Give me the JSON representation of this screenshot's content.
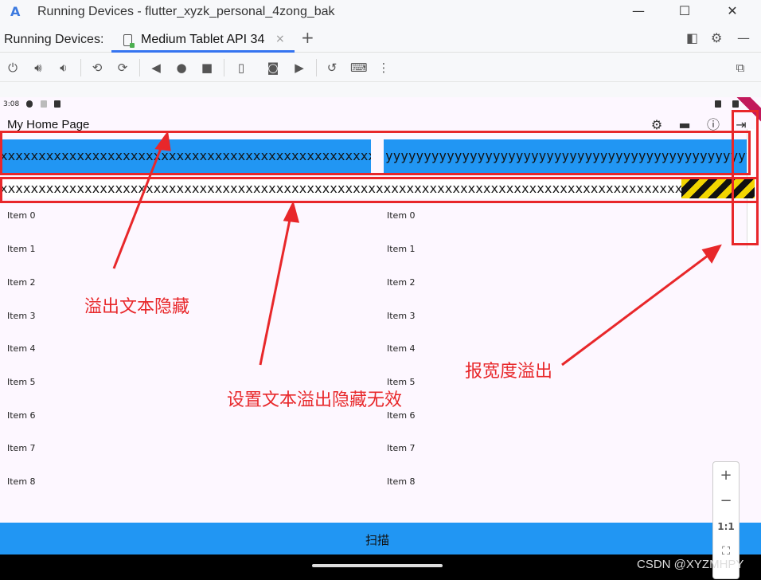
{
  "window": {
    "title": "Running Devices - flutter_xyzk_personal_4zong_bak",
    "minimize": "—",
    "maximize": "☐",
    "close": "✕"
  },
  "tabbar": {
    "label": "Running Devices:",
    "tab_label": "Medium Tablet API 34",
    "tab_close": "×",
    "add": "+"
  },
  "device": {
    "time": "3:08",
    "appbar_title": "My Home Page",
    "box1_text": "xxxxxxxxxxxxxxxxxxxxxxxxxxxxxxxxxxxxxxxxxxxxxxxxxxxxxxxx",
    "box2_text": "yyyyyyyyyyyyyyyyyyyyyyyyyyyyyyyyyyyyyyyyyyyyyyyyyyyyyyyy",
    "row2_text": "xxxxxxxxxxxxxxxxxxxxxxxxxxxxxxxxxxxxxxxxxxxxxxxxxxxxxxxxxxxxxxxxxxxxxxxxxxxxxxxxxxxxxxxxxxxxxx",
    "list_left": [
      "Item 0",
      "Item 1",
      "Item 2",
      "Item 3",
      "Item 4",
      "Item 5",
      "Item 6",
      "Item 7",
      "Item 8"
    ],
    "list_right": [
      "Item 0",
      "Item 1",
      "Item 2",
      "Item 3",
      "Item 4",
      "Item 5",
      "Item 6",
      "Item 7",
      "Item 8"
    ],
    "scan_button": "扫描"
  },
  "zoom": {
    "plus": "+",
    "minus": "−",
    "one_to_one": "1:1"
  },
  "annotations": {
    "hide_overflow": "溢出文本隐藏",
    "setting_invalid": "设置文本溢出隐藏无效",
    "width_overflow": "报宽度溢出"
  },
  "watermark": "CSDN @XYZMHPY",
  "colors": {
    "accent_blue": "#2196f3",
    "annotation_red": "#e8272a",
    "tab_indicator": "#3574f0"
  }
}
